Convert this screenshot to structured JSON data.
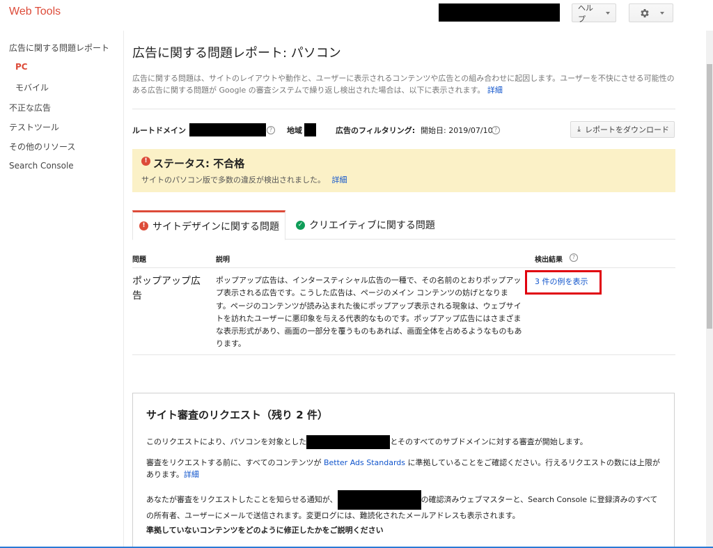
{
  "app": {
    "title": "Web Tools"
  },
  "header": {
    "help_label": "ヘルプ"
  },
  "sidebar": {
    "items": [
      {
        "label": "広告に関する問題レポート"
      },
      {
        "label": "PC"
      },
      {
        "label": "モバイル"
      },
      {
        "label": "不正な広告"
      },
      {
        "label": "テストツール"
      },
      {
        "label": "その他のリソース"
      },
      {
        "label": "Search Console"
      }
    ]
  },
  "main": {
    "title": "広告に関する問題レポート: パソコン",
    "description": "広告に関する問題は、サイトのレイアウトや動作と、ユーザーに表示されるコンテンツや広告との組み合わせに起因します。ユーザーを不快にさせる可能性のある広告に関する問題が Google の審査システムで繰り返し検出された場合は、以下に表示されます。",
    "description_link": "詳細",
    "filters": {
      "root_domain_label": "ルートドメイン",
      "region_label": "地域",
      "ad_filter_label": "広告のフィルタリング:",
      "ad_filter_value": "開始日: 2019/07/10"
    },
    "download_label": "レポートをダウンロード",
    "status": {
      "title": "ステータス: 不合格",
      "text": "サイトのパソコン版で多数の違反が検出されました。",
      "link": "詳細"
    },
    "tabs": [
      {
        "label": "サイトデザインに関する問題",
        "status": "error"
      },
      {
        "label": "クリエイティブに関する問題",
        "status": "ok"
      }
    ],
    "table": {
      "headers": [
        "問題",
        "説明",
        "検出結果"
      ],
      "rows": [
        {
          "issue": "ポップアップ広告",
          "description": "ポップアップ広告は、インタースティシャル広告の一種で、その名前のとおりポップアップ表示される広告です。こうした広告は、ページのメイン コンテンツの妨げとなります。ページのコンテンツが読み込まれた後にポップアップ表示される現象は、ウェブサイトを訪れたユーザーに悪印象を与える代表的なものです。ポップアップ広告にはさまざまな表示形式があり、画面の一部分を覆うものもあれば、画面全体を占めるようなものもあります。",
          "result": "3 件の例を表示"
        }
      ]
    }
  },
  "request": {
    "title": "サイト審査のリクエスト（残り 2 件）",
    "p1_before": "このリクエストにより、パソコンを対象とした",
    "p1_after": "とそのすべてのサブドメインに対する審査が開始します。",
    "p2_before": "審査をリクエストする前に、すべてのコンテンツが ",
    "p2_link": "Better Ads Standards",
    "p2_after": " に準拠していることをご確認ください。行えるリクエストの数には上限があります。",
    "p2_link2": "詳細",
    "p3_before": "あなたが審査をリクエストしたことを知らせる通知が、",
    "p3_after": "の確認済みウェブマスターと、Search Console に登録済みのすべての所有者、ユーザーにメールで送信されます。変更ログには、難読化されたメールアドレスも表示されます。",
    "question": "準拠していないコンテンツをどのように修正したかをご説明ください"
  },
  "colors": {
    "brand": "#dd4b39",
    "link": "#1155cc",
    "status_bg": "#fbf1c7",
    "ok": "#0f9d58",
    "highlight": "#e0000e"
  }
}
